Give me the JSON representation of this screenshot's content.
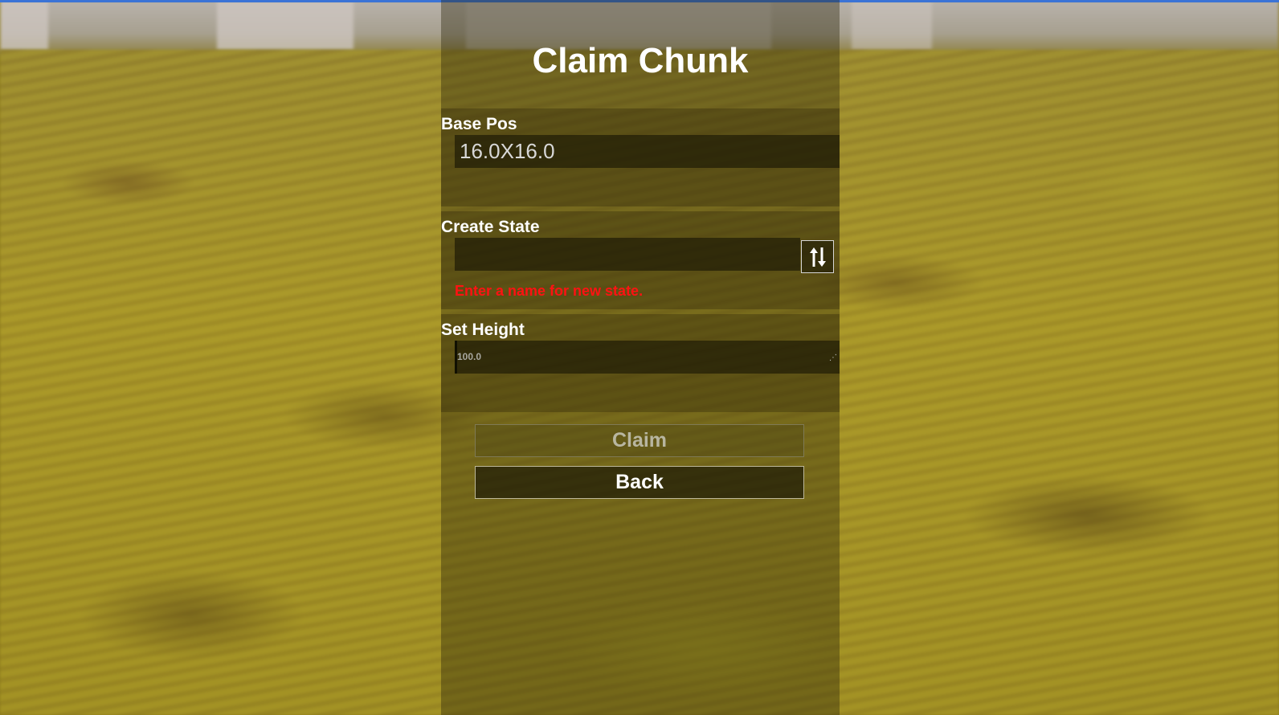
{
  "title": "Claim Chunk",
  "base_pos": {
    "label": "Base Pos",
    "value": "16.0X16.0"
  },
  "create_state": {
    "label": "Create State",
    "input_value": "",
    "swap_icon": "swap-vertical-arrows-icon",
    "error": "Enter a name for new state."
  },
  "set_height": {
    "label": "Set Height",
    "value": "100.0"
  },
  "buttons": {
    "claim": "Claim",
    "back": "Back"
  },
  "colors": {
    "error": "#ff1212",
    "accent_line": "#3b73d6"
  }
}
